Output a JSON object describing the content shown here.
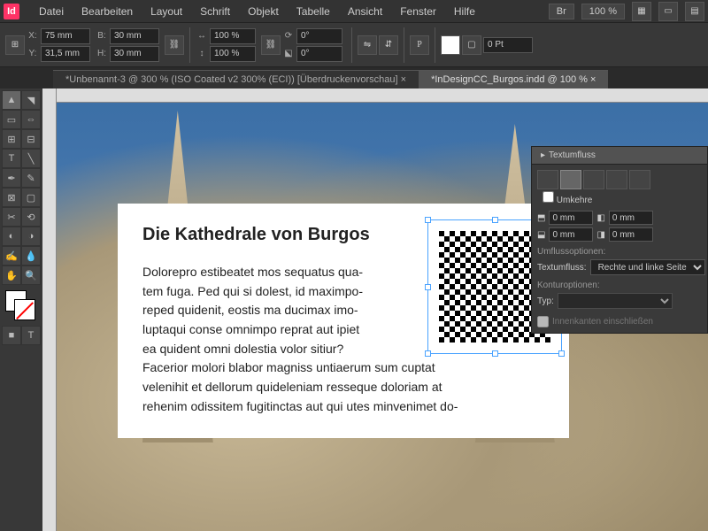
{
  "menu": [
    "Datei",
    "Bearbeiten",
    "Layout",
    "Schrift",
    "Objekt",
    "Tabelle",
    "Ansicht",
    "Fenster",
    "Hilfe"
  ],
  "workspace": "Br",
  "zoom": "100 %",
  "control": {
    "x": "75 mm",
    "y": "31,5 mm",
    "w": "30 mm",
    "h": "30 mm",
    "sx": "100 %",
    "sy": "100 %",
    "rot": "0°",
    "shear": "0°",
    "stroke": "0 Pt"
  },
  "tabs": [
    {
      "label": "*Unbenannt-3 @ 300 % (ISO Coated v2 300% (ECI)) [Überdruckenvorschau] ×",
      "active": false
    },
    {
      "label": "*InDesignCC_Burgos.indd @ 100 % ×",
      "active": true
    }
  ],
  "doc": {
    "title": "Die Kathedrale von Burgos",
    "body": "Dolorepro estibeatet mos sequatus qua-\ntem fuga. Ped qui si dolest, id maximpo-\nreped quidenit, eostis ma ducimax imo-\nluptaqui conse omnimpo reprat aut ipiet\nea quident omni dolestia volor sitiur?\nFacerior molori blabor magniss untiaerum sum cuptat\nvelenihit et dellorum quideleniam resseque doloriam at\nrehenim odissitem fugitinctas aut qui utes minvenimet do-"
  },
  "panel": {
    "title": "Textumfluss",
    "invert": "Umkehre",
    "offsets": {
      "t": "0 mm",
      "b": "0 mm",
      "l": "0 mm",
      "r": "0 mm"
    },
    "opts_label": "Umflussoptionen:",
    "wrap_label": "Textumfluss:",
    "wrap_value": "Rechte und linke Seite",
    "contour_label": "Konturoptionen:",
    "type_label": "Typ:",
    "include": "Innenkanten einschließen"
  }
}
